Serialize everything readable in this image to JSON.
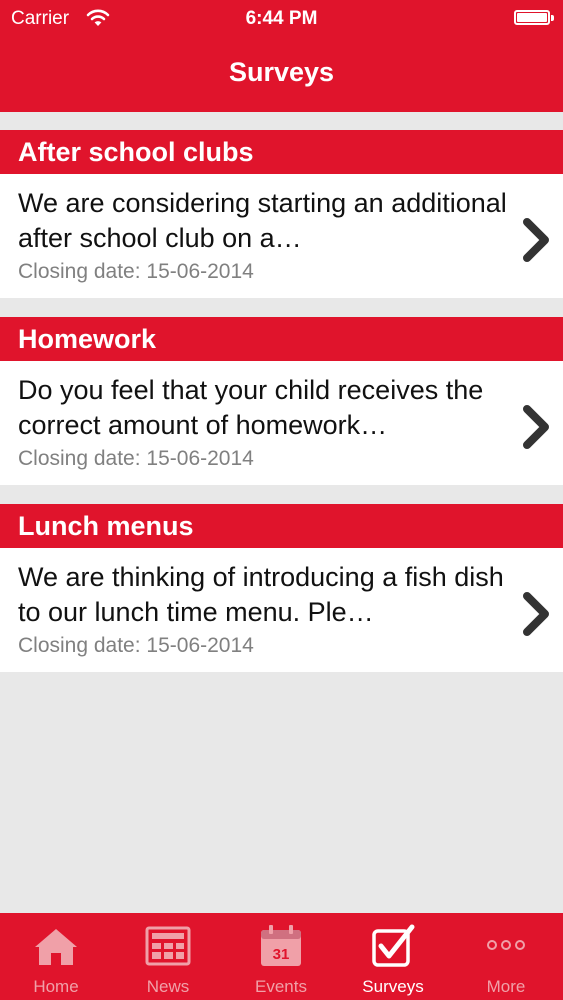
{
  "status_bar": {
    "carrier": "Carrier",
    "time": "6:44 PM"
  },
  "nav": {
    "title": "Surveys"
  },
  "surveys": [
    {
      "category": "After school clubs",
      "description": "We are considering starting an additional after school club on a…",
      "closing": "Closing date: 15-06-2014"
    },
    {
      "category": "Homework",
      "description": "Do you feel that your child receives the correct amount of homework…",
      "closing": "Closing date: 15-06-2014"
    },
    {
      "category": "Lunch menus",
      "description": "We are thinking of introducing a fish dish to our lunch time menu.  Ple…",
      "closing": "Closing date: 15-06-2014"
    }
  ],
  "tabs": [
    {
      "label": "Home",
      "icon": "home-icon",
      "active": false
    },
    {
      "label": "News",
      "icon": "news-icon",
      "active": false
    },
    {
      "label": "Events",
      "icon": "calendar-icon",
      "calendar_day": "31",
      "active": false
    },
    {
      "label": "Surveys",
      "icon": "checkbox-icon",
      "active": true
    },
    {
      "label": "More",
      "icon": "more-icon",
      "active": false
    }
  ],
  "colors": {
    "brand_red": "#e0142c",
    "background": "#e8e8e8",
    "inactive_tab": "#f0a0a8",
    "chevron": "#333333"
  }
}
